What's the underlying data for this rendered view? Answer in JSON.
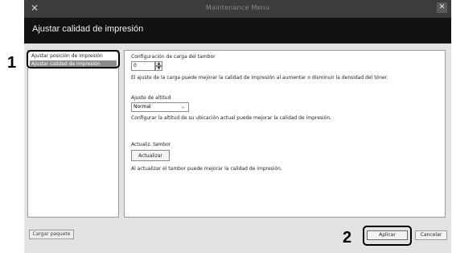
{
  "window": {
    "title": "Maintenance Menu",
    "heading": "Ajustar calidad de impresión"
  },
  "callouts": {
    "one": "1",
    "two": "2"
  },
  "sidebar": {
    "items": [
      {
        "label": "Ajustar posición de impresión"
      },
      {
        "label": "Ajustar calidad de impresión",
        "selected": true
      }
    ]
  },
  "panel": {
    "drum_charge_label": "Configuración de carga del tambor",
    "drum_charge_value": "0",
    "drum_charge_help": "El ajuste de la carga puede mejorar la calidad de impresión al aumentar o disminuir la densidad del tóner.",
    "altitude_label": "Ajuste de altitud",
    "altitude_value": "Normal",
    "altitude_help": "Configurar la altitud de su ubicación actual puede mejorar la calidad de impresión.",
    "refresh_label": "Actualiz. tambor",
    "refresh_button": "Actualizar",
    "refresh_help": "Al actualizar el tambor puede mejorar la calidad de impresión."
  },
  "footer": {
    "load_package": "Cargar paquete",
    "apply": "Aplicar",
    "cancel": "Cancelar"
  },
  "icons": {
    "app": "tools-icon",
    "close": "close-icon",
    "spin_up": "spin-up-icon",
    "spin_down": "spin-down-icon",
    "dropdown": "chevron-down-icon"
  }
}
